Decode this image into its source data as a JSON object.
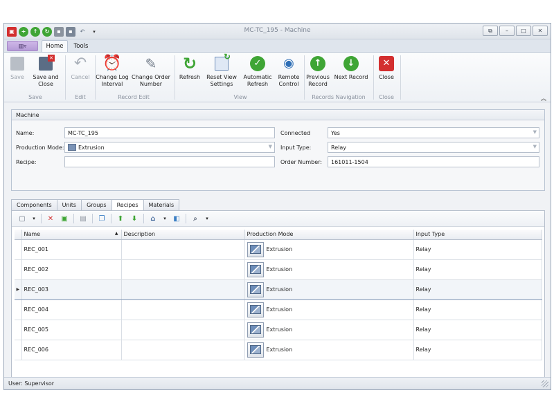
{
  "window": {
    "title": "MC-TC_195 - Machine"
  },
  "ribbon": {
    "tabs": [
      {
        "label": "Home",
        "active": true
      },
      {
        "label": "Tools",
        "active": false
      }
    ],
    "groups": [
      {
        "name": "Save",
        "buttons": [
          {
            "label": "Save",
            "icon": "disk-icon",
            "enabled": false
          },
          {
            "label": "Save and Close",
            "icon": "disk-close-icon",
            "enabled": true
          }
        ]
      },
      {
        "name": "Edit",
        "buttons": [
          {
            "label": "Cancel",
            "icon": "undo-icon",
            "enabled": false
          }
        ]
      },
      {
        "name": "Record Edit",
        "buttons": [
          {
            "label": "Change Log Interval",
            "icon": "alarm-clock-icon",
            "enabled": true
          },
          {
            "label": "Change Order Number",
            "icon": "pencil-document-icon",
            "enabled": true
          }
        ]
      },
      {
        "name": "View",
        "buttons": [
          {
            "label": "Refresh",
            "icon": "refresh-icon",
            "enabled": true
          },
          {
            "label": "Reset View Settings",
            "icon": "reset-view-icon",
            "enabled": true
          },
          {
            "label": "Automatic Refresh",
            "icon": "check-circle-icon",
            "enabled": true
          },
          {
            "label": "Remote Control",
            "icon": "eye-icon",
            "enabled": true
          }
        ]
      },
      {
        "name": "Records Navigation",
        "buttons": [
          {
            "label": "Previous Record",
            "icon": "arrow-up-circle-icon",
            "enabled": true
          },
          {
            "label": "Next Record",
            "icon": "arrow-down-circle-icon",
            "enabled": true
          }
        ]
      },
      {
        "name": "Close",
        "buttons": [
          {
            "label": "Close",
            "icon": "close-icon",
            "enabled": true
          }
        ]
      }
    ]
  },
  "machine": {
    "header": "Machine",
    "name_label": "Name:",
    "name_value": "MC-TC_195",
    "production_mode_label": "Production Mode:",
    "production_mode_value": "Extrusion",
    "recipe_label": "Recipe:",
    "recipe_value": "",
    "connected_label": "Connected",
    "connected_value": "Yes",
    "input_type_label": "Input Type:",
    "input_type_value": "Relay",
    "order_number_label": "Order Number:",
    "order_number_value": "161011-1504"
  },
  "tabs": [
    {
      "label": "Components",
      "active": false
    },
    {
      "label": "Units",
      "active": false
    },
    {
      "label": "Groups",
      "active": false
    },
    {
      "label": "Recipes",
      "active": true
    },
    {
      "label": "Materials",
      "active": false
    }
  ],
  "grid": {
    "columns": [
      "Name",
      "Description",
      "Production Mode",
      "Input Type"
    ],
    "sort_indicator": "▲",
    "selected_row": 2,
    "rows": [
      {
        "name": "REC_001",
        "description": "",
        "production_mode": "Extrusion",
        "input_type": "Relay"
      },
      {
        "name": "REC_002",
        "description": "",
        "production_mode": "Extrusion",
        "input_type": "Relay"
      },
      {
        "name": "REC_003",
        "description": "",
        "production_mode": "Extrusion",
        "input_type": "Relay"
      },
      {
        "name": "REC_004",
        "description": "",
        "production_mode": "Extrusion",
        "input_type": "Relay"
      },
      {
        "name": "REC_005",
        "description": "",
        "production_mode": "Extrusion",
        "input_type": "Relay"
      },
      {
        "name": "REC_006",
        "description": "",
        "production_mode": "Extrusion",
        "input_type": "Relay"
      }
    ]
  },
  "status": {
    "user": "User: Supervisor"
  },
  "colors": {
    "green": "#3fa535",
    "red": "#d32f2f",
    "accent_purple": "#b49ad6"
  }
}
